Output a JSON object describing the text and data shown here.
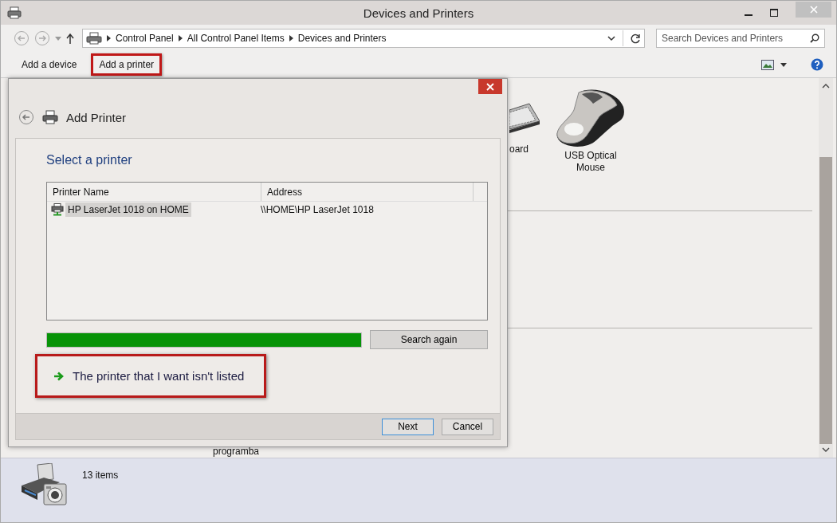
{
  "window": {
    "title": "Devices and Printers"
  },
  "address_bar": {
    "breadcrumbs": [
      "Control Panel",
      "All Control Panel Items",
      "Devices and Printers"
    ]
  },
  "search": {
    "placeholder": "Search Devices and Printers"
  },
  "toolbar": {
    "buttons": [
      {
        "label": "Add a device",
        "highlighted": false
      },
      {
        "label": "Add a printer",
        "highlighted": true
      }
    ]
  },
  "devices": [
    {
      "label": "oard",
      "kind": "keyboard"
    },
    {
      "label": "USB Optical Mouse",
      "kind": "mouse"
    }
  ],
  "hidden_device": {
    "label": "programba"
  },
  "dialog": {
    "title": "Add Printer",
    "heading": "Select a printer",
    "columns": [
      "Printer Name",
      "Address"
    ],
    "rows": [
      {
        "name": "HP LaserJet 1018 on HOME",
        "address": "\\\\HOME\\HP LaserJet 1018",
        "selected": true
      }
    ],
    "progress": {
      "level": 1
    },
    "search_button": "Search again",
    "link": {
      "label": "The printer that I want isn't listed",
      "highlighted": true
    },
    "buttons": [
      {
        "label": "Next",
        "default": true
      },
      {
        "label": "Cancel",
        "default": false
      }
    ]
  },
  "status_bar": {
    "count": "13 items"
  }
}
